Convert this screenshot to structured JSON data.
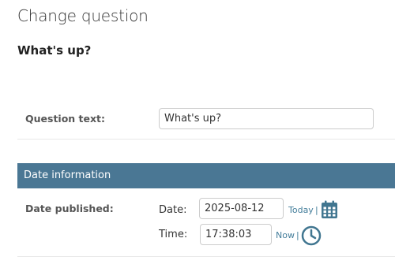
{
  "page": {
    "title": "Change question",
    "object_title": "What's up?"
  },
  "question_row": {
    "label": "Question text:",
    "value": "What's up?"
  },
  "fieldset": {
    "title": "Date information"
  },
  "date_row": {
    "label": "Date published:",
    "date_label": "Date:",
    "date_value": "2025-08-12",
    "today_link": "Today",
    "time_label": "Time:",
    "time_value": "17:38:03",
    "now_link": "Now",
    "separator": "|"
  },
  "icons": {
    "calendar": "calendar-icon",
    "clock": "clock-icon"
  },
  "colors": {
    "fieldset_header": "#4a7794",
    "link": "#447e9b",
    "icon": "#417690"
  }
}
